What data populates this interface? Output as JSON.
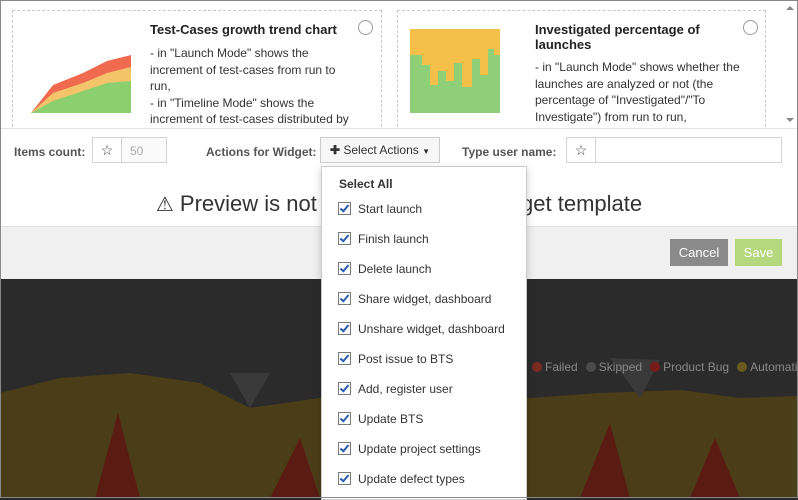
{
  "cards": [
    {
      "title": "Test-Cases growth trend chart",
      "desc_lines": [
        "- in \"Launch Mode\" shows the",
        "increment of test-cases from run to",
        "run,",
        "- in \"Timeline Mode\" shows the",
        "increment of test-cases distributed by"
      ]
    },
    {
      "title_lines": [
        "Investigated percentage of",
        "launches"
      ],
      "desc_lines": [
        "- in \"Launch Mode\" shows whether the",
        "launches are analyzed or not (the",
        "percentage of \"Investigated\"/\"To",
        "Investigate\") from run to run,"
      ]
    }
  ],
  "controls": {
    "items_count_label": "Items count:",
    "items_count_value": "50",
    "actions_label": "Actions for Widget:",
    "select_actions_label": "Select Actions",
    "user_name_label": "Type user name:"
  },
  "preview_text": "Preview is not available for this widget template",
  "footer": {
    "cancel": "Cancel",
    "save": "Save"
  },
  "dropdown": {
    "select_all": "Select All",
    "items": [
      "Start launch",
      "Finish launch",
      "Delete launch",
      "Share widget, dashboard",
      "Unshare widget, dashboard",
      "Post issue to BTS",
      "Add, register user",
      "Update BTS",
      "Update project settings",
      "Update defect types"
    ]
  },
  "legend": [
    "Failed",
    "Skipped",
    "Product Bug",
    "Automation"
  ],
  "colors": {
    "cancel": "#8a8a8a",
    "save": "#b5d77e",
    "failed": "#7a2a22",
    "skipped": "#4a4a4a",
    "product_bug": "#7a1a1a",
    "automation": "#6b5a1e"
  }
}
